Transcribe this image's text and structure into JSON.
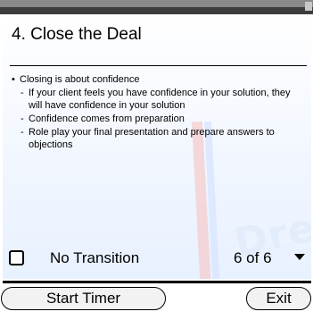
{
  "slide": {
    "title": "4. Close the Deal",
    "bullet": "Closing is about confidence",
    "subpoints": [
      "If your client feels you have confidence in your solution, they will have confidence in your solution",
      "Confidence comes from preparation",
      "Role play your final presentation and prepare answers to objections"
    ],
    "watermark_text": "Dre"
  },
  "controls": {
    "transition_label": "No Transition",
    "transition_checked": false,
    "page_indicator": "6 of 6"
  },
  "progress": {
    "fraction": 1.0
  },
  "toolbar": {
    "start_timer_label": "Start Timer",
    "exit_label": "Exit"
  },
  "icons": {
    "dropdown": "chevron-down-icon",
    "checkbox": "checkbox-icon"
  }
}
